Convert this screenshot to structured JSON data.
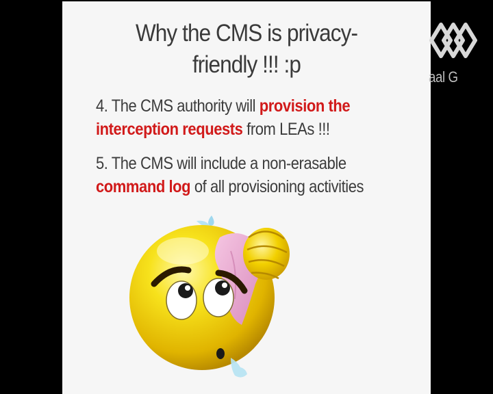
{
  "slide": {
    "title_line1": "Why the CMS is privacy-",
    "title_line2": "friendly !!! :p",
    "points": [
      {
        "prefix": "4. The CMS authority will ",
        "highlight_a": "provision the",
        "highlight_b": "interception requests",
        "suffix": " from LEAs !!!"
      },
      {
        "prefix": "5. The CMS will include a non-erasable",
        "highlight": "command log",
        "suffix": " of all provisioning activities"
      }
    ],
    "emoji_icon": "worried-sweating-emoji-icon"
  },
  "watermark": {
    "text": "aal G",
    "logo_icon": "diamond-logo-icon"
  },
  "colors": {
    "background": "#000000",
    "slide": "#f6f6f6",
    "text": "#3c3c3c",
    "highlight": "#d11a1a",
    "emoji_face": "#f2d400",
    "towel": "#e9a6cf"
  }
}
